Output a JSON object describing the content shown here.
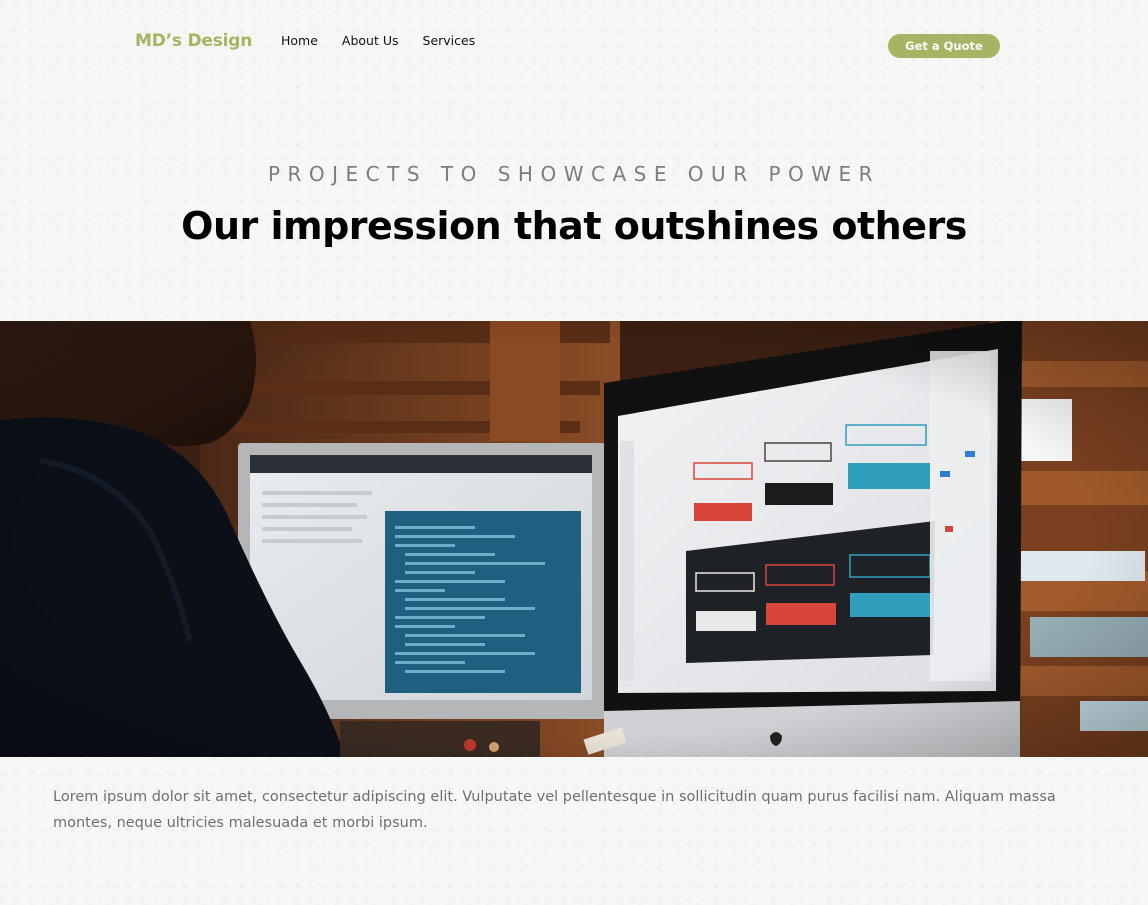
{
  "brand": {
    "logo_text": "MD’s Design",
    "accent_color": "#a6b463"
  },
  "nav": {
    "items": [
      {
        "label": "Home"
      },
      {
        "label": "About Us"
      },
      {
        "label": "Services"
      }
    ],
    "cta_label": "Get a Quote"
  },
  "intro": {
    "eyebrow": "PROJECTS TO SHOWCASE OUR POWER",
    "headline": "Our impression that outshines others"
  },
  "hero_image": {
    "screen_buttons": [
      "STATIC STATE BUTTON UI",
      "STATIC STATE BUTTON UI",
      "STATIC STATE BUTTON UI",
      "HOVER STATE BUTTON UI",
      "HOVER STATE BUTTON UI",
      "HOVER STATE BUTTON UI",
      "STATIC STATE BUTTON UI",
      "STATIC STATE BUTTON UI",
      "STATIC STATE BUTTON UI",
      "HOVER STATE BUTTON UI",
      "HOVER STATE BUTTON UI",
      "HOVER STATE BUTTON UI"
    ]
  },
  "description": {
    "text": "Lorem ipsum dolor sit amet, consectetur adipiscing elit. Vulputate vel pellentesque in sollicitudin quam purus facilisi nam. Aliquam massa montes, neque ultricies malesuada et morbi ipsum."
  }
}
